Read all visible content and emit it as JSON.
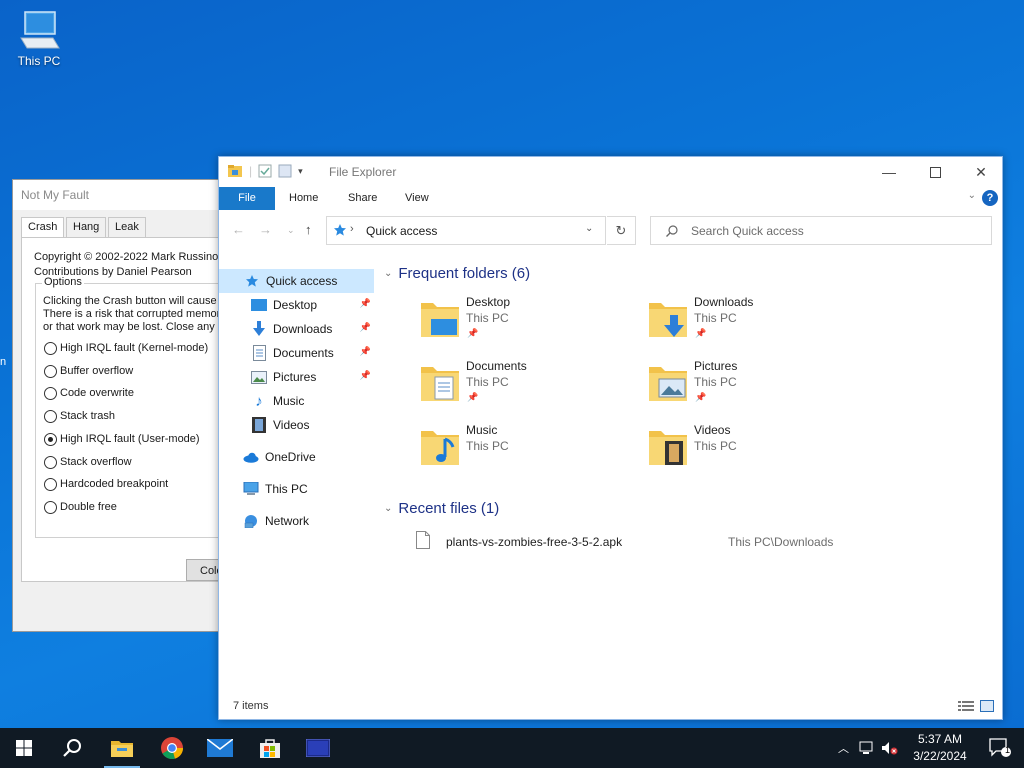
{
  "desktop": {
    "this_pc_label": "This PC",
    "edge_text": "n"
  },
  "notmyfault": {
    "title": "Not My Fault",
    "tabs": [
      "Crash",
      "Hang",
      "Leak"
    ],
    "copyright": "Copyright © 2002-2022 Mark Russinov",
    "contributions": "Contributions by Daniel Pearson",
    "options_label": "Options",
    "description": [
      "Clicking the Crash button will cause t",
      "There is a risk that corrupted memory",
      "or that work may be lost. Close any c"
    ],
    "options": [
      {
        "label": "High IRQL fault (Kernel-mode)",
        "checked": false
      },
      {
        "label": "Buffer overflow",
        "checked": false
      },
      {
        "label": "Code overwrite",
        "checked": false
      },
      {
        "label": "Stack trash",
        "checked": false
      },
      {
        "label": "High IRQL fault (User-mode)",
        "checked": true
      },
      {
        "label": "Stack overflow",
        "checked": false
      },
      {
        "label": "Hardcoded breakpoint",
        "checked": false
      },
      {
        "label": "Double free",
        "checked": false
      }
    ],
    "button_label": "Colo"
  },
  "explorer": {
    "title": "File Explorer",
    "ribbon_tabs": {
      "file": "File",
      "home": "Home",
      "share": "Share",
      "view": "View"
    },
    "help": "?",
    "address": "Quick access",
    "search_placeholder": "Search Quick access",
    "sidebar": {
      "quick_access": "Quick access",
      "desktop": "Desktop",
      "downloads": "Downloads",
      "documents": "Documents",
      "pictures": "Pictures",
      "music": "Music",
      "videos": "Videos",
      "onedrive": "OneDrive",
      "this_pc": "This PC",
      "network": "Network"
    },
    "frequent_header": "Frequent folders (6)",
    "folders": [
      {
        "name": "Desktop",
        "location": "This PC",
        "pinned": true
      },
      {
        "name": "Downloads",
        "location": "This PC",
        "pinned": true
      },
      {
        "name": "Documents",
        "location": "This PC",
        "pinned": true
      },
      {
        "name": "Pictures",
        "location": "This PC",
        "pinned": true
      },
      {
        "name": "Music",
        "location": "This PC",
        "pinned": false
      },
      {
        "name": "Videos",
        "location": "This PC",
        "pinned": false
      }
    ],
    "recent_header": "Recent files (1)",
    "recent_files": [
      {
        "name": "plants-vs-zombies-free-3-5-2.apk",
        "path": "This PC\\Downloads"
      }
    ],
    "status": "7 items"
  },
  "taskbar": {
    "time": "5:37 AM",
    "date": "3/22/2024",
    "notification_count": "1"
  },
  "colors": {
    "accent": "#1979ca",
    "selection": "#cce8ff",
    "header_text": "#1e3287",
    "taskbar": "#101a24"
  }
}
